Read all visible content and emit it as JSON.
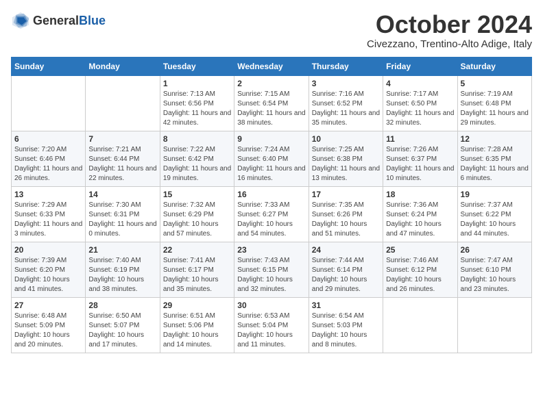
{
  "header": {
    "logo_general": "General",
    "logo_blue": "Blue",
    "month_title": "October 2024",
    "subtitle": "Civezzano, Trentino-Alto Adige, Italy"
  },
  "days_of_week": [
    "Sunday",
    "Monday",
    "Tuesday",
    "Wednesday",
    "Thursday",
    "Friday",
    "Saturday"
  ],
  "weeks": [
    [
      {
        "day": "",
        "info": ""
      },
      {
        "day": "",
        "info": ""
      },
      {
        "day": "1",
        "info": "Sunrise: 7:13 AM\nSunset: 6:56 PM\nDaylight: 11 hours and 42 minutes."
      },
      {
        "day": "2",
        "info": "Sunrise: 7:15 AM\nSunset: 6:54 PM\nDaylight: 11 hours and 38 minutes."
      },
      {
        "day": "3",
        "info": "Sunrise: 7:16 AM\nSunset: 6:52 PM\nDaylight: 11 hours and 35 minutes."
      },
      {
        "day": "4",
        "info": "Sunrise: 7:17 AM\nSunset: 6:50 PM\nDaylight: 11 hours and 32 minutes."
      },
      {
        "day": "5",
        "info": "Sunrise: 7:19 AM\nSunset: 6:48 PM\nDaylight: 11 hours and 29 minutes."
      }
    ],
    [
      {
        "day": "6",
        "info": "Sunrise: 7:20 AM\nSunset: 6:46 PM\nDaylight: 11 hours and 26 minutes."
      },
      {
        "day": "7",
        "info": "Sunrise: 7:21 AM\nSunset: 6:44 PM\nDaylight: 11 hours and 22 minutes."
      },
      {
        "day": "8",
        "info": "Sunrise: 7:22 AM\nSunset: 6:42 PM\nDaylight: 11 hours and 19 minutes."
      },
      {
        "day": "9",
        "info": "Sunrise: 7:24 AM\nSunset: 6:40 PM\nDaylight: 11 hours and 16 minutes."
      },
      {
        "day": "10",
        "info": "Sunrise: 7:25 AM\nSunset: 6:38 PM\nDaylight: 11 hours and 13 minutes."
      },
      {
        "day": "11",
        "info": "Sunrise: 7:26 AM\nSunset: 6:37 PM\nDaylight: 11 hours and 10 minutes."
      },
      {
        "day": "12",
        "info": "Sunrise: 7:28 AM\nSunset: 6:35 PM\nDaylight: 11 hours and 6 minutes."
      }
    ],
    [
      {
        "day": "13",
        "info": "Sunrise: 7:29 AM\nSunset: 6:33 PM\nDaylight: 11 hours and 3 minutes."
      },
      {
        "day": "14",
        "info": "Sunrise: 7:30 AM\nSunset: 6:31 PM\nDaylight: 11 hours and 0 minutes."
      },
      {
        "day": "15",
        "info": "Sunrise: 7:32 AM\nSunset: 6:29 PM\nDaylight: 10 hours and 57 minutes."
      },
      {
        "day": "16",
        "info": "Sunrise: 7:33 AM\nSunset: 6:27 PM\nDaylight: 10 hours and 54 minutes."
      },
      {
        "day": "17",
        "info": "Sunrise: 7:35 AM\nSunset: 6:26 PM\nDaylight: 10 hours and 51 minutes."
      },
      {
        "day": "18",
        "info": "Sunrise: 7:36 AM\nSunset: 6:24 PM\nDaylight: 10 hours and 47 minutes."
      },
      {
        "day": "19",
        "info": "Sunrise: 7:37 AM\nSunset: 6:22 PM\nDaylight: 10 hours and 44 minutes."
      }
    ],
    [
      {
        "day": "20",
        "info": "Sunrise: 7:39 AM\nSunset: 6:20 PM\nDaylight: 10 hours and 41 minutes."
      },
      {
        "day": "21",
        "info": "Sunrise: 7:40 AM\nSunset: 6:19 PM\nDaylight: 10 hours and 38 minutes."
      },
      {
        "day": "22",
        "info": "Sunrise: 7:41 AM\nSunset: 6:17 PM\nDaylight: 10 hours and 35 minutes."
      },
      {
        "day": "23",
        "info": "Sunrise: 7:43 AM\nSunset: 6:15 PM\nDaylight: 10 hours and 32 minutes."
      },
      {
        "day": "24",
        "info": "Sunrise: 7:44 AM\nSunset: 6:14 PM\nDaylight: 10 hours and 29 minutes."
      },
      {
        "day": "25",
        "info": "Sunrise: 7:46 AM\nSunset: 6:12 PM\nDaylight: 10 hours and 26 minutes."
      },
      {
        "day": "26",
        "info": "Sunrise: 7:47 AM\nSunset: 6:10 PM\nDaylight: 10 hours and 23 minutes."
      }
    ],
    [
      {
        "day": "27",
        "info": "Sunrise: 6:48 AM\nSunset: 5:09 PM\nDaylight: 10 hours and 20 minutes."
      },
      {
        "day": "28",
        "info": "Sunrise: 6:50 AM\nSunset: 5:07 PM\nDaylight: 10 hours and 17 minutes."
      },
      {
        "day": "29",
        "info": "Sunrise: 6:51 AM\nSunset: 5:06 PM\nDaylight: 10 hours and 14 minutes."
      },
      {
        "day": "30",
        "info": "Sunrise: 6:53 AM\nSunset: 5:04 PM\nDaylight: 10 hours and 11 minutes."
      },
      {
        "day": "31",
        "info": "Sunrise: 6:54 AM\nSunset: 5:03 PM\nDaylight: 10 hours and 8 minutes."
      },
      {
        "day": "",
        "info": ""
      },
      {
        "day": "",
        "info": ""
      }
    ]
  ]
}
